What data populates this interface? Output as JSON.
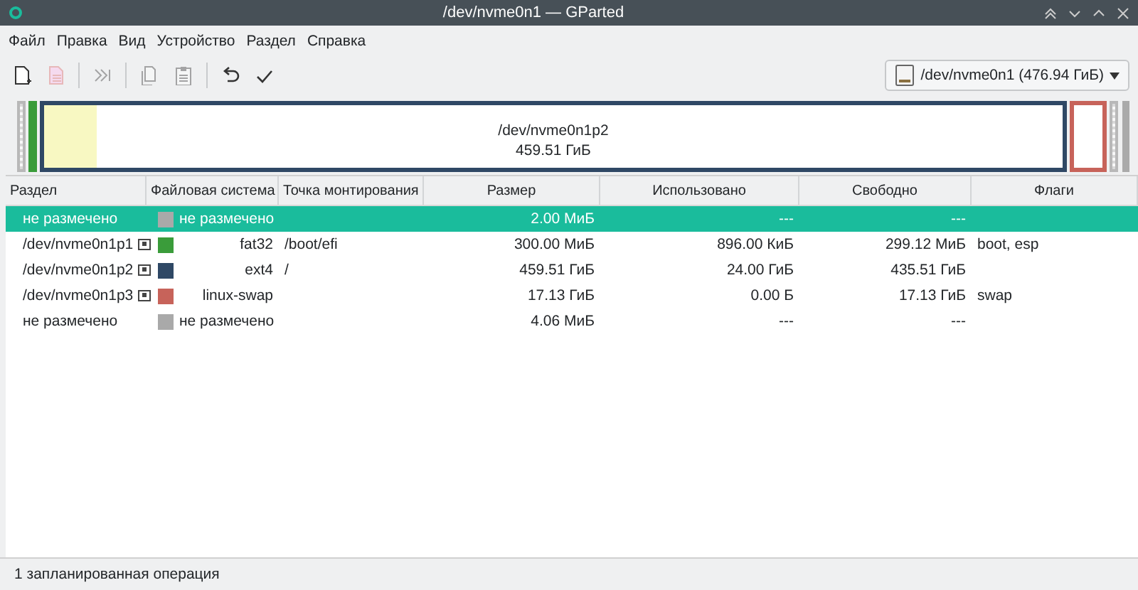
{
  "window": {
    "title": "/dev/nvme0n1 — GParted"
  },
  "menu": [
    "Файл",
    "Правка",
    "Вид",
    "Устройство",
    "Раздел",
    "Справка"
  ],
  "toolbar": [
    {
      "kind": "new",
      "disabled": false
    },
    {
      "kind": "delete",
      "disabled": true
    },
    {
      "kind": "sep"
    },
    {
      "kind": "resize",
      "disabled": true
    },
    {
      "kind": "sep"
    },
    {
      "kind": "copy",
      "disabled": true
    },
    {
      "kind": "paste",
      "disabled": true
    },
    {
      "kind": "sep"
    },
    {
      "kind": "undo",
      "disabled": false
    },
    {
      "kind": "apply",
      "disabled": false
    }
  ],
  "device_selector": {
    "label": "/dev/nvme0n1 (476.94 ГиБ)"
  },
  "disk_map": {
    "segments": [
      {
        "kind": "unallocated"
      },
      {
        "kind": "partition",
        "color": "#3a9c3a"
      },
      {
        "kind": "partition",
        "color": "#2f4865",
        "level": 0.052,
        "name": "/dev/nvme0n1p2",
        "size": "459.51 ГиБ"
      },
      {
        "kind": "partition",
        "color": "#c7635a"
      },
      {
        "kind": "unallocated"
      }
    ]
  },
  "table": {
    "columns": [
      "Раздел",
      "Файловая система",
      "Точка монтирования",
      "Размер",
      "Использовано",
      "Свободно",
      "Флаги"
    ],
    "rows": [
      {
        "partition": "не размечено",
        "locked": false,
        "color": "#a9a9a9",
        "filesystem": "не размечено",
        "mount": "",
        "size": "2.00 МиБ",
        "used": "---",
        "free": "---",
        "flags": "",
        "selected": true
      },
      {
        "partition": "/dev/nvme0n1p1",
        "locked": true,
        "color": "#3a9c3a",
        "filesystem": "fat32",
        "mount": "/boot/efi",
        "size": "300.00 МиБ",
        "used": "896.00 КиБ",
        "free": "299.12 МиБ",
        "flags": "boot, esp",
        "selected": false
      },
      {
        "partition": "/dev/nvme0n1p2",
        "locked": true,
        "color": "#2f4865",
        "filesystem": "ext4",
        "mount": "/",
        "size": "459.51 ГиБ",
        "used": "24.00 ГиБ",
        "free": "435.51 ГиБ",
        "flags": "",
        "selected": false
      },
      {
        "partition": "/dev/nvme0n1p3",
        "locked": true,
        "color": "#c7635a",
        "filesystem": "linux-swap",
        "mount": "",
        "size": "17.13 ГиБ",
        "used": "0.00 Б",
        "free": "17.13 ГиБ",
        "flags": "swap",
        "selected": false
      },
      {
        "partition": "не размечено",
        "locked": false,
        "color": "#a9a9a9",
        "filesystem": "не размечено",
        "mount": "",
        "size": "4.06 МиБ",
        "used": "---",
        "free": "---",
        "flags": "",
        "selected": false
      }
    ]
  },
  "status_bar": {
    "text": "1 запланированная операция"
  }
}
